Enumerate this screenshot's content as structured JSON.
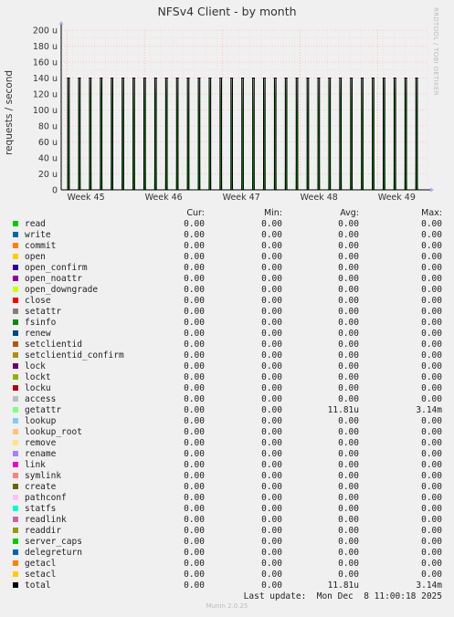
{
  "title": "NFSv4 Client - by month",
  "watermark": "RRDTOOL / TOBI OETIKER",
  "colors": {
    "axis": "#000000",
    "grid": "#ff9999",
    "spike_line": "#000000",
    "spike_fill": "#00cc00"
  },
  "chart_data": {
    "type": "line",
    "ylabel": "requests / second",
    "yticks": [
      "0",
      "20 u",
      "40 u",
      "60 u",
      "80 u",
      "100 u",
      "120 u",
      "140 u",
      "160 u",
      "180 u",
      "200 u"
    ],
    "ylim": [
      0,
      200
    ],
    "xticks": [
      "Week 45",
      "Week 46",
      "Week 47",
      "Week 48",
      "Week 49"
    ],
    "grid": true,
    "series": [
      {
        "name": "getattr",
        "color": "#00cc00",
        "description": "periodic spikes to ~140 u (once per day), otherwise 0",
        "spike_count": 33,
        "spike_value": 140
      }
    ]
  },
  "legend": {
    "headers": {
      "cur": "Cur:",
      "min": "Min:",
      "avg": "Avg:",
      "max": "Max:"
    },
    "rows": [
      {
        "name": "read",
        "color": "#00cc00",
        "cur": "0.00",
        "min": "0.00",
        "avg": "0.00",
        "max": "0.00"
      },
      {
        "name": "write",
        "color": "#0066b3",
        "cur": "0.00",
        "min": "0.00",
        "avg": "0.00",
        "max": "0.00"
      },
      {
        "name": "commit",
        "color": "#ff8000",
        "cur": "0.00",
        "min": "0.00",
        "avg": "0.00",
        "max": "0.00"
      },
      {
        "name": "open",
        "color": "#ffcc00",
        "cur": "0.00",
        "min": "0.00",
        "avg": "0.00",
        "max": "0.00"
      },
      {
        "name": "open_confirm",
        "color": "#330099",
        "cur": "0.00",
        "min": "0.00",
        "avg": "0.00",
        "max": "0.00"
      },
      {
        "name": "open_noattr",
        "color": "#990099",
        "cur": "0.00",
        "min": "0.00",
        "avg": "0.00",
        "max": "0.00"
      },
      {
        "name": "open_downgrade",
        "color": "#ccff00",
        "cur": "0.00",
        "min": "0.00",
        "avg": "0.00",
        "max": "0.00"
      },
      {
        "name": "close",
        "color": "#ff0000",
        "cur": "0.00",
        "min": "0.00",
        "avg": "0.00",
        "max": "0.00"
      },
      {
        "name": "setattr",
        "color": "#808080",
        "cur": "0.00",
        "min": "0.00",
        "avg": "0.00",
        "max": "0.00"
      },
      {
        "name": "fsinfo",
        "color": "#008f00",
        "cur": "0.00",
        "min": "0.00",
        "avg": "0.00",
        "max": "0.00"
      },
      {
        "name": "renew",
        "color": "#00487d",
        "cur": "0.00",
        "min": "0.00",
        "avg": "0.00",
        "max": "0.00"
      },
      {
        "name": "setclientid",
        "color": "#b35a00",
        "cur": "0.00",
        "min": "0.00",
        "avg": "0.00",
        "max": "0.00"
      },
      {
        "name": "setclientid_confirm",
        "color": "#b38f00",
        "cur": "0.00",
        "min": "0.00",
        "avg": "0.00",
        "max": "0.00"
      },
      {
        "name": "lock",
        "color": "#6b006b",
        "cur": "0.00",
        "min": "0.00",
        "avg": "0.00",
        "max": "0.00"
      },
      {
        "name": "lockt",
        "color": "#8fb300",
        "cur": "0.00",
        "min": "0.00",
        "avg": "0.00",
        "max": "0.00"
      },
      {
        "name": "locku",
        "color": "#b30000",
        "cur": "0.00",
        "min": "0.00",
        "avg": "0.00",
        "max": "0.00"
      },
      {
        "name": "access",
        "color": "#bebebe",
        "cur": "0.00",
        "min": "0.00",
        "avg": "0.00",
        "max": "0.00"
      },
      {
        "name": "getattr",
        "color": "#80ff80",
        "cur": "0.00",
        "min": "0.00",
        "avg": "11.81u",
        "max": "3.14m"
      },
      {
        "name": "lookup",
        "color": "#80c9ff",
        "cur": "0.00",
        "min": "0.00",
        "avg": "0.00",
        "max": "0.00"
      },
      {
        "name": "lookup_root",
        "color": "#ffc080",
        "cur": "0.00",
        "min": "0.00",
        "avg": "0.00",
        "max": "0.00"
      },
      {
        "name": "remove",
        "color": "#ffe680",
        "cur": "0.00",
        "min": "0.00",
        "avg": "0.00",
        "max": "0.00"
      },
      {
        "name": "rename",
        "color": "#aa80ff",
        "cur": "0.00",
        "min": "0.00",
        "avg": "0.00",
        "max": "0.00"
      },
      {
        "name": "link",
        "color": "#ee00cc",
        "cur": "0.00",
        "min": "0.00",
        "avg": "0.00",
        "max": "0.00"
      },
      {
        "name": "symlink",
        "color": "#ff8080",
        "cur": "0.00",
        "min": "0.00",
        "avg": "0.00",
        "max": "0.00"
      },
      {
        "name": "create",
        "color": "#666600",
        "cur": "0.00",
        "min": "0.00",
        "avg": "0.00",
        "max": "0.00"
      },
      {
        "name": "pathconf",
        "color": "#ffbfff",
        "cur": "0.00",
        "min": "0.00",
        "avg": "0.00",
        "max": "0.00"
      },
      {
        "name": "statfs",
        "color": "#00ffcc",
        "cur": "0.00",
        "min": "0.00",
        "avg": "0.00",
        "max": "0.00"
      },
      {
        "name": "readlink",
        "color": "#cc6699",
        "cur": "0.00",
        "min": "0.00",
        "avg": "0.00",
        "max": "0.00"
      },
      {
        "name": "readdir",
        "color": "#999900",
        "cur": "0.00",
        "min": "0.00",
        "avg": "0.00",
        "max": "0.00"
      },
      {
        "name": "server_caps",
        "color": "#00cc00",
        "cur": "0.00",
        "min": "0.00",
        "avg": "0.00",
        "max": "0.00"
      },
      {
        "name": "delegreturn",
        "color": "#0066b3",
        "cur": "0.00",
        "min": "0.00",
        "avg": "0.00",
        "max": "0.00"
      },
      {
        "name": "getacl",
        "color": "#ff8000",
        "cur": "0.00",
        "min": "0.00",
        "avg": "0.00",
        "max": "0.00"
      },
      {
        "name": "setacl",
        "color": "#ffcc00",
        "cur": "0.00",
        "min": "0.00",
        "avg": "0.00",
        "max": "0.00"
      },
      {
        "name": "total",
        "color": "#000000",
        "cur": "0.00",
        "min": "0.00",
        "avg": "11.81u",
        "max": "3.14m"
      }
    ]
  },
  "last_update": "Last update:  Mon Dec  8 11:00:18 2025",
  "munin_version": "Munin 2.0.25"
}
